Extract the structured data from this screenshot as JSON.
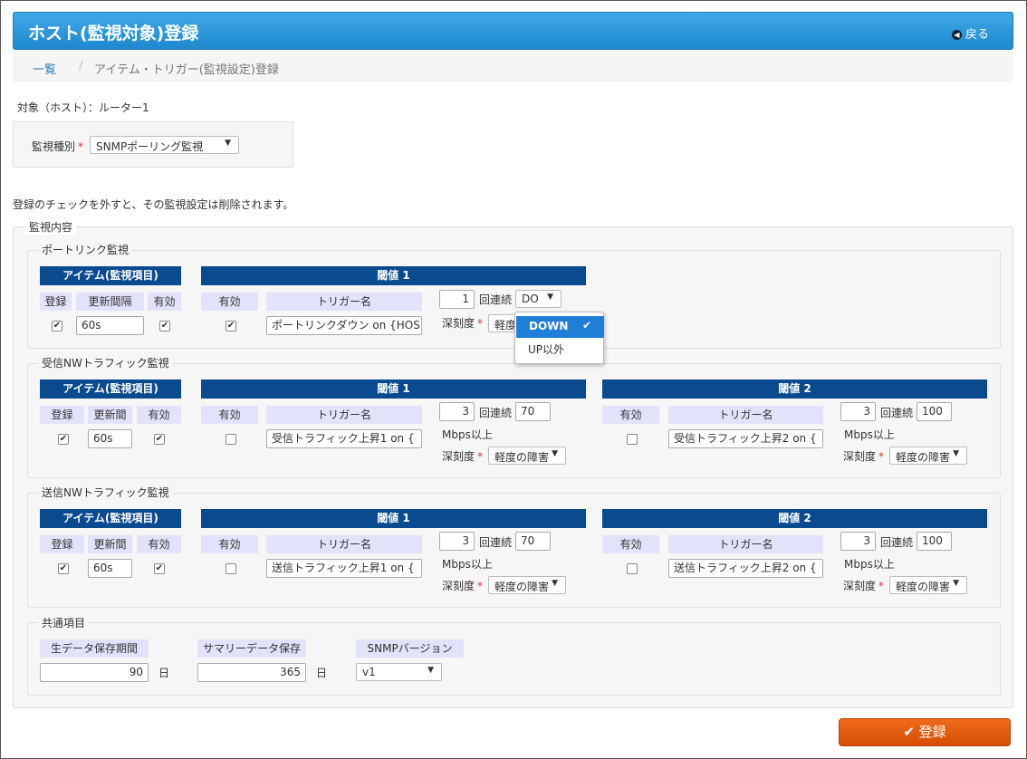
{
  "header": {
    "title": "ホスト(監視対象)登録",
    "back_label": "戻る"
  },
  "breadcrumb": {
    "link": "一覧",
    "separator": "/",
    "current": "アイテム・トリガー(監視設定)登録"
  },
  "target": "対象（ホスト）：ルーター1",
  "monitor_type": {
    "label": "監視種別",
    "value": "SNMPポーリング監視"
  },
  "note": "登録のチェックを外すと、その監視設定は削除されます。",
  "main_legend": "監視内容",
  "common_headers": {
    "item": "アイテム(監視項目)",
    "register": "登録",
    "enabled": "有効",
    "trigger_name": "トリガー名",
    "threshold1": "閾値 1",
    "threshold2": "閾値 2",
    "times": "回連続",
    "mbps": "Mbps以上",
    "severity": "深刻度"
  },
  "port_link": {
    "legend": "ポートリンク監視",
    "interval_label": "更新間隔",
    "interval": "60s",
    "t1": {
      "trigger": "ポートリンクダウン on {HOS",
      "count": "1",
      "state": "DO",
      "severity": "軽度の障害"
    }
  },
  "rx": {
    "legend": "受信NWトラフィック監視",
    "interval_label": "更新間",
    "interval": "60s",
    "t1": {
      "trigger": "受信トラフィック上昇1 on {",
      "count": "3",
      "value": "70",
      "severity": "軽度の障害"
    },
    "t2": {
      "trigger": "受信トラフィック上昇2 on {",
      "count": "3",
      "value": "100",
      "severity": "軽度の障害"
    }
  },
  "tx": {
    "legend": "送信NWトラフィック監視",
    "interval_label": "更新間",
    "interval": "60s",
    "t1": {
      "trigger": "送信トラフィック上昇1 on {",
      "count": "3",
      "value": "70",
      "severity": "軽度の障害"
    },
    "t2": {
      "trigger": "送信トラフィック上昇2 on {",
      "count": "3",
      "value": "100",
      "severity": "軽度の障害"
    }
  },
  "common": {
    "legend": "共通項目",
    "raw_label": "生データ保存期間",
    "raw_value": "90",
    "summary_label": "サマリーデータ保存",
    "summary_value": "365",
    "day": "日",
    "snmp_label": "SNMPバージョン",
    "snmp_value": "v1"
  },
  "dropdown": {
    "options": [
      "DOWN",
      "UP以外"
    ],
    "selected": "DOWN"
  },
  "submit_label": "登録",
  "colors": {
    "header": "#1f88cf",
    "bar": "#0a4a8f",
    "label_bg": "#e2e2fa",
    "submit": "#d44e05",
    "selected": "#1f7fd6"
  }
}
